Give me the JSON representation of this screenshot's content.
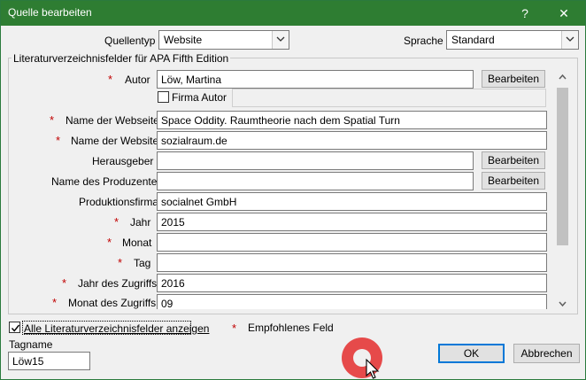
{
  "window": {
    "title": "Quelle bearbeiten",
    "help_glyph": "?",
    "close_glyph": "✕"
  },
  "source_type": {
    "label": "Quellentyp",
    "value": "Website"
  },
  "language": {
    "label": "Sprache",
    "value": "Standard"
  },
  "group": {
    "legend": "Literaturverzeichnisfelder für APA Fifth Edition"
  },
  "required_marker": "*",
  "fields": {
    "author": {
      "label": "Autor",
      "value": "Löw, Martina",
      "button": "Bearbeiten"
    },
    "corporate_author": {
      "label": "Firma Autor",
      "value": ""
    },
    "website_name": {
      "label": "Name der Webseite",
      "value": "Space Oddity. Raumtheorie nach dem Spatial Turn"
    },
    "site_name": {
      "label": "Name der Website",
      "value": "sozialraum.de"
    },
    "publisher": {
      "label": "Herausgeber",
      "value": "",
      "button": "Bearbeiten"
    },
    "producer_name": {
      "label": "Name des Produzenten",
      "value": "",
      "button": "Bearbeiten"
    },
    "production_company": {
      "label": "Produktionsfirma",
      "value": "socialnet GmbH"
    },
    "year": {
      "label": "Jahr",
      "value": "2015"
    },
    "month": {
      "label": "Monat",
      "value": ""
    },
    "day": {
      "label": "Tag",
      "value": ""
    },
    "year_accessed": {
      "label": "Jahr des Zugriffs",
      "value": "2016"
    },
    "month_accessed": {
      "label": "Monat des Zugriffs",
      "value": "09"
    }
  },
  "show_all": {
    "label": "Alle Literaturverzeichnisfelder anzeigen",
    "checked": true
  },
  "legend_recommended": "Empfohlenes Feld",
  "tag": {
    "label": "Tagname",
    "value": "Löw15"
  },
  "buttons": {
    "ok": "OK",
    "cancel": "Abbrechen"
  },
  "colors": {
    "titlebar": "#2e7d32",
    "required": "#c00000",
    "ok_border": "#0078d7",
    "click_highlight": "#e64a4a"
  }
}
